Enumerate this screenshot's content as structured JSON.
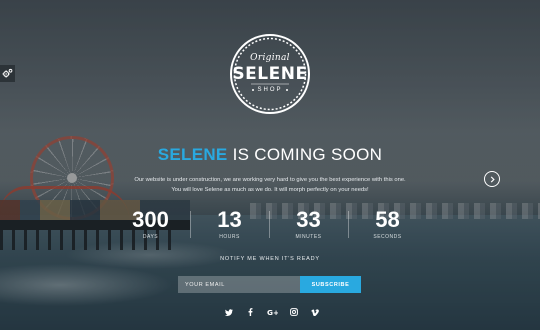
{
  "logo": {
    "top_text": "Original",
    "main_text": "SELENE",
    "bottom_text": "SHOP"
  },
  "headline": {
    "accent": "SELENE",
    "rest": " IS COMING SOON"
  },
  "description": {
    "line1": "Our website is under construction, we are working very hard to give you the best experience with this one.",
    "line2": "You will love Selene as much as we do. It will morph perfectly on your needs!"
  },
  "countdown": [
    {
      "value": "300",
      "label": "DAYS"
    },
    {
      "value": "13",
      "label": "HOURS"
    },
    {
      "value": "33",
      "label": "MINUTES"
    },
    {
      "value": "58",
      "label": "SECONDS"
    }
  ],
  "notify": {
    "label": "NOTIFY ME WHEN IT'S READY",
    "email_placeholder": "YOUR EMAIL",
    "subscribe_label": "SUBSCRIBE"
  },
  "social_icons": [
    "twitter-icon",
    "facebook-icon",
    "google-plus-icon",
    "instagram-icon",
    "vimeo-icon"
  ],
  "colors": {
    "accent": "#29a9e0",
    "text": "#ffffff"
  }
}
